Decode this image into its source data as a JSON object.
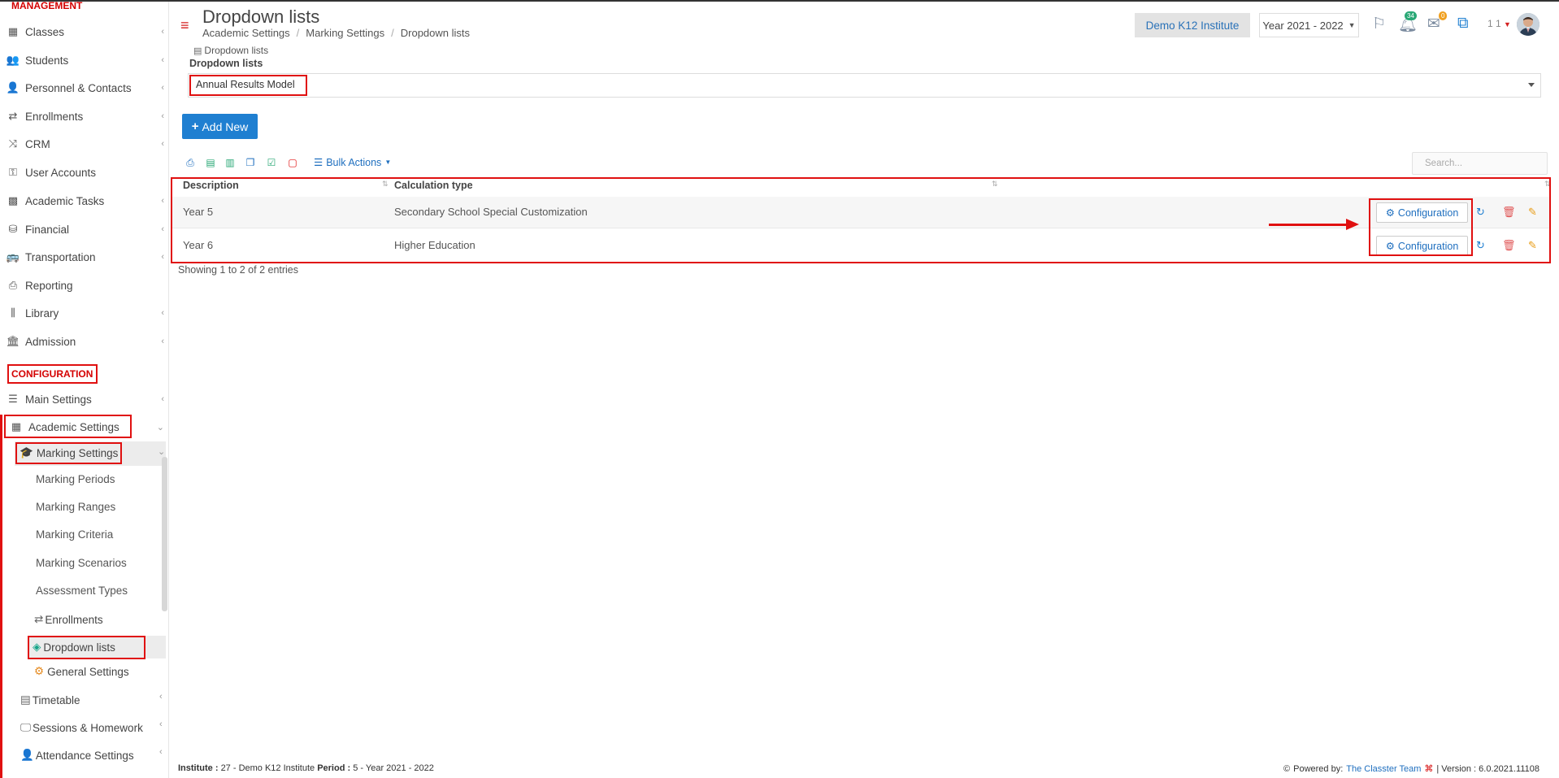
{
  "sidebar": {
    "management_header": "MANAGEMENT",
    "items": [
      {
        "label": "Classes",
        "icon": "classes-icon"
      },
      {
        "label": "Students",
        "icon": "students-icon"
      },
      {
        "label": "Personnel & Contacts",
        "icon": "personnel-icon"
      },
      {
        "label": "Enrollments",
        "icon": "enrollments-icon"
      },
      {
        "label": "CRM",
        "icon": "crm-icon"
      },
      {
        "label": "User Accounts",
        "icon": "key-icon"
      },
      {
        "label": "Academic Tasks",
        "icon": "tasks-icon"
      },
      {
        "label": "Financial",
        "icon": "coins-icon"
      },
      {
        "label": "Transportation",
        "icon": "bus-icon"
      },
      {
        "label": "Reporting",
        "icon": "printer-icon"
      },
      {
        "label": "Library",
        "icon": "library-icon"
      },
      {
        "label": "Admission",
        "icon": "bank-icon"
      }
    ],
    "configuration_header": "CONFIGURATION",
    "main_settings": "Main Settings",
    "academic_settings": "Academic Settings",
    "marking_settings": "Marking Settings",
    "marking_children": [
      "Marking Periods",
      "Marking Ranges",
      "Marking Criteria",
      "Marking Scenarios",
      "Assessment Types"
    ],
    "enrollments_sub": "Enrollments",
    "dropdown_lists": "Dropdown lists",
    "general_settings": "General Settings",
    "timetable": "Timetable",
    "sessions_homework": "Sessions & Homework",
    "attendance_settings": "Attendance Settings"
  },
  "header": {
    "title": "Dropdown lists",
    "breadcrumb": [
      "Academic Settings",
      "Marking Settings",
      "Dropdown lists"
    ],
    "institute": "Demo K12 Institute",
    "year": "Year 2021 - 2022",
    "notifications_count": "34",
    "messages_count": "0",
    "user_label": "1 1"
  },
  "main": {
    "panel_tab": "Dropdown lists",
    "dropdown_label": "Dropdown lists",
    "dropdown_value": "Annual Results Model",
    "add_new": "Add New",
    "bulk_actions": "Bulk Actions",
    "search_placeholder": "Search...",
    "columns": [
      "Description",
      "Calculation type"
    ],
    "rows": [
      {
        "description": "Year 5",
        "calculation_type": "Secondary School Special Customization",
        "action": "Configuration"
      },
      {
        "description": "Year 6",
        "calculation_type": "Higher Education",
        "action": "Configuration"
      }
    ],
    "showing": "Showing 1 to 2 of 2 entries"
  },
  "footer": {
    "institute_label": "Institute :",
    "institute_value": "27 - Demo K12 Institute",
    "period_label": "Period :",
    "period_value": "5 - Year 2021 - 2022",
    "powered_by": "Powered by:",
    "team": "The Classter Team",
    "version": "| Version : 6.0.2021.11108"
  },
  "colors": {
    "accent": "#1f7fd1",
    "highlight_red": "#e01010",
    "brand_red": "#d40000"
  }
}
